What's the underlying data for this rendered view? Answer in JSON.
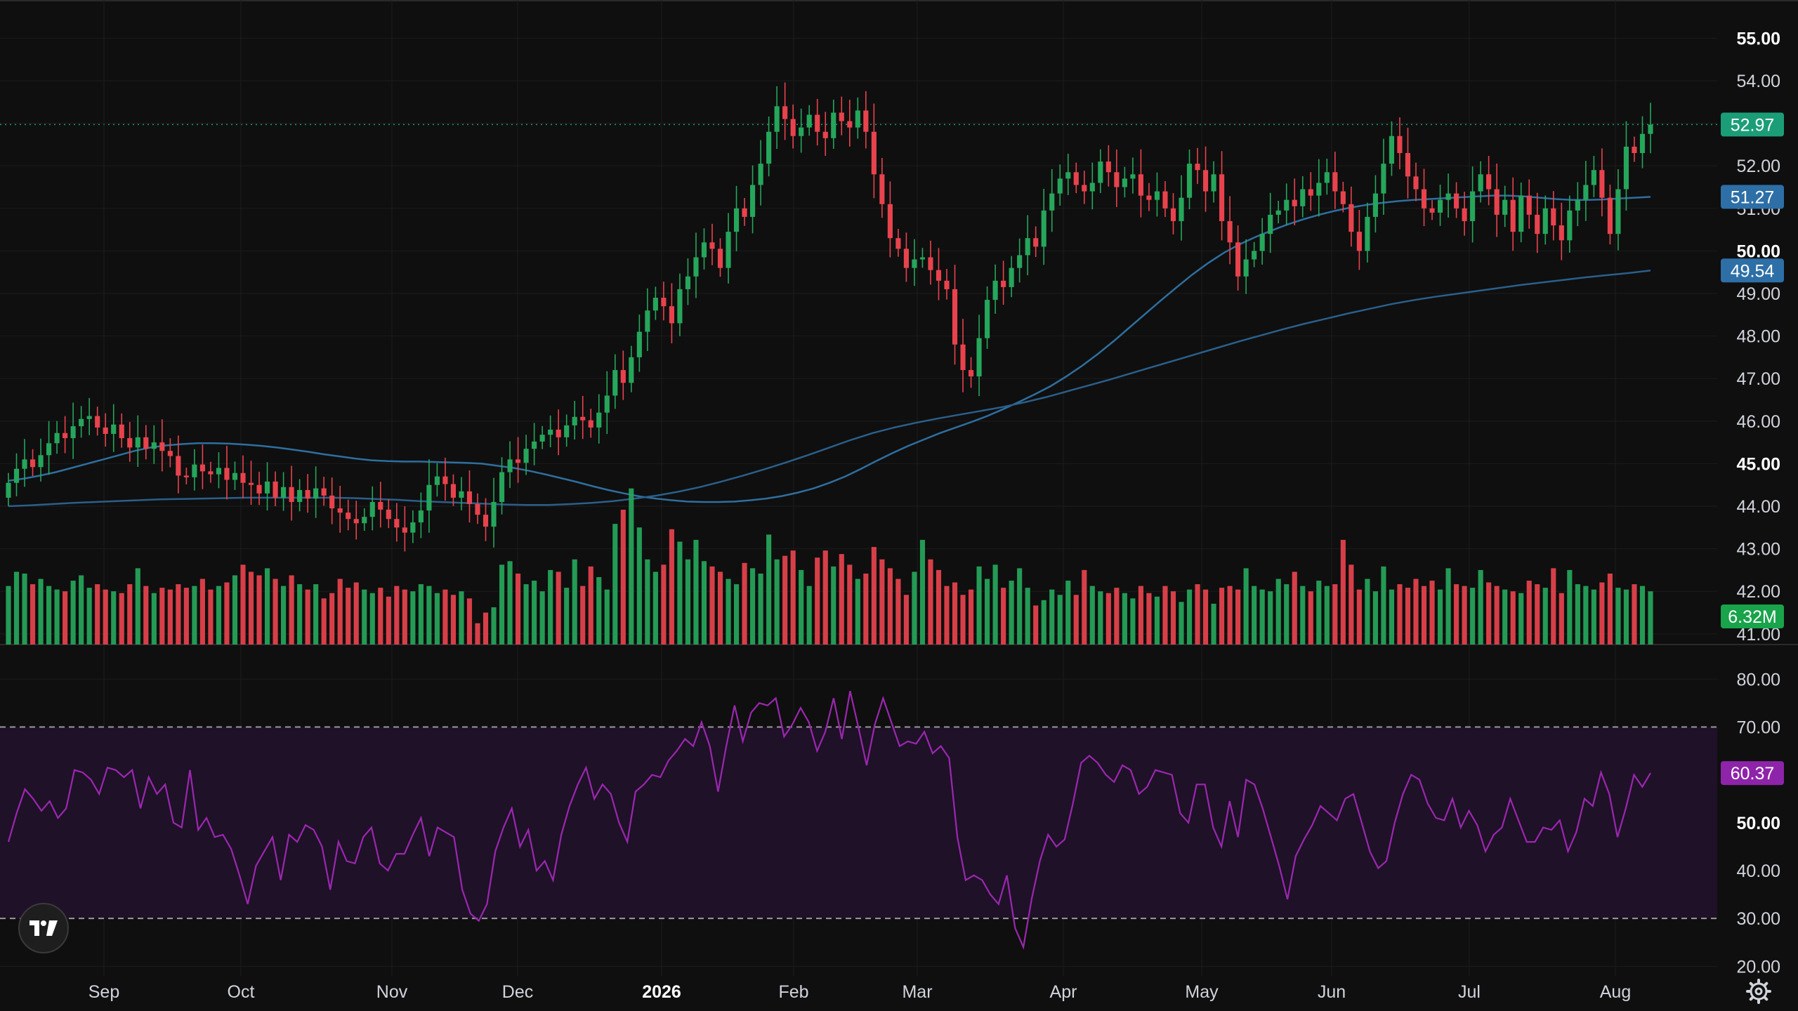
{
  "chart_data": {
    "type": "candlestick",
    "price_axis": {
      "range": [
        40.75,
        55.6
      ],
      "ticks": [
        "55.00",
        "54.00",
        "53.00",
        "52.00",
        "51.00",
        "50.00",
        "49.00",
        "48.00",
        "47.00",
        "46.00",
        "45.00",
        "44.00",
        "43.00",
        "42.00",
        "41.00"
      ],
      "bold_ticks": [
        "55.00",
        "50.00",
        "45.00"
      ]
    },
    "rsi_axis": {
      "range": [
        18,
        84
      ],
      "ticks": [
        "80.00",
        "70.00",
        "60.00",
        "50.00",
        "40.00",
        "30.00",
        "20.00"
      ],
      "bold_ticks": [
        "50.00"
      ],
      "band": [
        30,
        70
      ]
    },
    "time_axis": {
      "labels": [
        "Sep",
        "Oct",
        "Nov",
        "Dec",
        "2026",
        "Feb",
        "Mar",
        "Apr",
        "May",
        "Jun",
        "Jul",
        "Aug"
      ],
      "bold_labels": [
        "2026"
      ]
    },
    "badges": {
      "last_price": "52.97",
      "ma_fast": "51.27",
      "ma_slow": "49.54",
      "volume": "6.32M",
      "rsi": "60.37"
    },
    "colors": {
      "up": "#26a65b",
      "down": "#e8434d",
      "ma_fast": "#2e6fa0",
      "ma_slow": "#2b5f8a",
      "rsi_line": "#9c27b0",
      "rsi_band": "#1f1128",
      "background": "#0f0f0f",
      "grid": "#1c1c1c",
      "badge_price": "#1b9e77",
      "badge_ma": "#2d6fa6",
      "badge_volume": "#19a34a",
      "badge_rsi": "#8e24aa"
    },
    "candles": {
      "start_date": "2025-08-28",
      "close": [
        44.55,
        44.88,
        45.1,
        44.92,
        45.2,
        45.48,
        45.72,
        45.6,
        45.88,
        46.05,
        46.12,
        45.85,
        45.7,
        45.92,
        45.6,
        45.38,
        45.62,
        45.35,
        45.5,
        45.3,
        45.18,
        44.72,
        44.68,
        44.98,
        44.82,
        44.75,
        44.9,
        44.62,
        44.78,
        44.55,
        44.5,
        44.3,
        44.58,
        44.2,
        44.45,
        44.1,
        44.38,
        44.18,
        44.42,
        44.25,
        43.95,
        43.85,
        43.7,
        43.6,
        43.75,
        44.1,
        43.92,
        43.7,
        43.5,
        43.38,
        43.62,
        43.9,
        44.5,
        44.7,
        44.52,
        44.2,
        44.35,
        44.05,
        43.8,
        43.52,
        44.1,
        44.8,
        45.1,
        45.02,
        45.35,
        45.52,
        45.68,
        45.8,
        45.62,
        45.9,
        46.1,
        46.02,
        45.85,
        46.2,
        46.6,
        47.2,
        46.9,
        47.5,
        48.1,
        48.6,
        48.9,
        48.7,
        48.3,
        49.1,
        49.4,
        49.85,
        50.2,
        50.05,
        49.6,
        50.45,
        51.0,
        50.8,
        51.55,
        52.05,
        52.8,
        53.4,
        53.1,
        52.7,
        52.9,
        53.2,
        52.8,
        52.65,
        53.25,
        53.05,
        52.9,
        53.3,
        52.8,
        51.8,
        51.1,
        50.3,
        50.05,
        49.6,
        49.8,
        49.85,
        49.55,
        49.3,
        49.1,
        47.8,
        47.2,
        47.05,
        47.95,
        48.85,
        49.3,
        49.15,
        49.6,
        49.9,
        50.3,
        50.1,
        50.95,
        51.35,
        51.7,
        51.85,
        51.55,
        51.4,
        51.6,
        52.1,
        51.85,
        51.5,
        51.7,
        51.8,
        51.3,
        51.2,
        51.4,
        51.0,
        50.7,
        51.25,
        52.05,
        51.9,
        51.4,
        51.8,
        50.7,
        50.2,
        49.4,
        49.8,
        50.0,
        50.4,
        50.85,
        50.95,
        51.2,
        51.05,
        51.45,
        51.3,
        51.6,
        51.85,
        51.4,
        51.1,
        50.45,
        50.0,
        50.8,
        51.35,
        52.05,
        52.7,
        52.3,
        51.75,
        51.45,
        51.0,
        50.9,
        51.2,
        51.35,
        51.0,
        50.7,
        51.4,
        51.8,
        51.45,
        50.85,
        51.2,
        50.45,
        51.3,
        50.85,
        50.4,
        51.0,
        50.6,
        50.25,
        50.95,
        51.2,
        51.55,
        51.9,
        51.25,
        50.4,
        51.45,
        52.45,
        52.3,
        52.75,
        52.97
      ],
      "open": [
        44.2,
        44.55,
        44.88,
        45.1,
        44.92,
        45.2,
        45.48,
        45.72,
        45.6,
        45.88,
        46.05,
        46.12,
        45.85,
        45.7,
        45.92,
        45.6,
        45.38,
        45.62,
        45.35,
        45.5,
        45.3,
        45.18,
        44.72,
        44.68,
        44.98,
        44.82,
        44.75,
        44.9,
        44.62,
        44.78,
        44.55,
        44.5,
        44.3,
        44.58,
        44.2,
        44.45,
        44.1,
        44.38,
        44.18,
        44.42,
        44.25,
        43.95,
        43.85,
        43.7,
        43.6,
        43.75,
        44.1,
        43.92,
        43.7,
        43.5,
        43.38,
        43.62,
        43.9,
        44.5,
        44.7,
        44.52,
        44.2,
        44.35,
        44.05,
        43.8,
        43.52,
        44.1,
        44.8,
        45.1,
        45.02,
        45.35,
        45.52,
        45.68,
        45.8,
        45.62,
        45.9,
        46.1,
        46.02,
        45.85,
        46.2,
        46.6,
        47.2,
        46.9,
        47.5,
        48.1,
        48.6,
        48.9,
        48.7,
        48.3,
        49.1,
        49.4,
        49.85,
        50.2,
        50.05,
        49.6,
        50.45,
        51.0,
        50.8,
        51.55,
        52.05,
        52.8,
        53.4,
        53.1,
        52.7,
        52.9,
        53.2,
        52.8,
        52.65,
        53.25,
        53.05,
        52.9,
        53.3,
        52.8,
        51.8,
        51.1,
        50.3,
        50.05,
        49.6,
        49.8,
        49.85,
        49.55,
        49.3,
        49.1,
        47.8,
        47.2,
        47.05,
        47.95,
        48.85,
        49.3,
        49.15,
        49.6,
        49.9,
        50.3,
        50.1,
        50.95,
        51.35,
        51.7,
        51.85,
        51.55,
        51.4,
        51.6,
        52.1,
        51.85,
        51.5,
        51.7,
        51.8,
        51.3,
        51.2,
        51.4,
        51.0,
        50.7,
        51.25,
        52.05,
        51.9,
        51.4,
        51.8,
        50.7,
        50.2,
        49.4,
        49.8,
        50.0,
        50.4,
        50.85,
        50.95,
        51.2,
        51.05,
        51.45,
        51.3,
        51.6,
        51.85,
        51.4,
        51.1,
        50.45,
        50.0,
        50.8,
        51.35,
        52.05,
        52.7,
        52.3,
        51.75,
        51.45,
        51.0,
        50.9,
        51.2,
        51.35,
        51.0,
        50.7,
        51.4,
        51.8,
        51.45,
        50.85,
        51.2,
        50.45,
        51.3,
        50.85,
        50.4,
        51.0,
        50.6,
        50.25,
        50.95,
        51.2,
        51.55,
        51.9,
        51.25,
        50.4,
        51.45,
        52.45,
        52.3,
        52.75
      ],
      "volume_millions": [
        6.6,
        8.2,
        8.0,
        6.8,
        7.4,
        6.6,
        6.2,
        6.0,
        7.2,
        7.8,
        6.4,
        6.8,
        6.2,
        6.0,
        5.8,
        6.8,
        8.6,
        6.6,
        5.8,
        6.4,
        6.2,
        6.8,
        6.4,
        6.6,
        7.4,
        6.2,
        6.6,
        7.0,
        7.8,
        9.0,
        8.2,
        7.8,
        8.6,
        7.4,
        6.6,
        7.8,
        6.8,
        6.2,
        6.8,
        5.2,
        5.8,
        7.4,
        6.4,
        7.0,
        6.2,
        5.8,
        6.4,
        5.4,
        6.6,
        6.2,
        6.0,
        6.8,
        6.6,
        5.8,
        6.2,
        5.6,
        6.0,
        5.2,
        2.4,
        3.6,
        4.2,
        9.0,
        9.4,
        8.0,
        6.8,
        7.2,
        6.0,
        8.4,
        8.2,
        6.4,
        9.6,
        6.6,
        8.8,
        7.6,
        6.2,
        13.6,
        15.2,
        17.6,
        13.2,
        9.6,
        8.2,
        9.0,
        13.0,
        11.6,
        9.6,
        11.8,
        9.4,
        8.8,
        8.2,
        7.4,
        6.8,
        9.2,
        8.6,
        8.0,
        12.4,
        9.6,
        10.0,
        10.6,
        8.4,
        6.6,
        9.8,
        10.6,
        8.8,
        10.2,
        9.0,
        7.4,
        8.0,
        11.0,
        9.6,
        8.6,
        7.4,
        5.6,
        8.2,
        11.8,
        9.6,
        8.4,
        6.6,
        7.0,
        5.6,
        6.2,
        8.8,
        7.4,
        9.0,
        6.4,
        7.2,
        8.6,
        6.4,
        4.4,
        5.0,
        6.2,
        5.6,
        7.2,
        5.6,
        8.4,
        6.6,
        6.0,
        5.8,
        6.4,
        5.8,
        5.2,
        6.6,
        5.8,
        5.4,
        6.6,
        6.0,
        4.8,
        6.2,
        6.8,
        6.2,
        4.6,
        6.4,
        6.6,
        6.2,
        8.6,
        6.6,
        6.2,
        6.0,
        7.4,
        6.8,
        8.2,
        6.6,
        6.0,
        7.2,
        6.6,
        6.8,
        11.8,
        9.0,
        6.2,
        7.4,
        6.0,
        8.8,
        6.2,
        6.8,
        6.4,
        7.4,
        6.6,
        7.2,
        6.2,
        8.6,
        6.8,
        6.6,
        6.4,
        8.4,
        7.0,
        6.6,
        6.2,
        6.0,
        5.8,
        7.2,
        6.8,
        6.4,
        8.6,
        5.8,
        8.4,
        6.8,
        6.6,
        6.2,
        7.0,
        8.0,
        6.4,
        6.2,
        6.8,
        6.6,
        6.0,
        5.8,
        6.2,
        6.8,
        7.0,
        6.2,
        6.6,
        6.4,
        6.8,
        7.8,
        6.4,
        6.2,
        6.0,
        8.4,
        6.32
      ]
    },
    "rsi": {
      "start_date": "2025-08-28",
      "values": [
        46.0,
        52.0,
        57.0,
        55.0,
        52.5,
        54.5,
        51.0,
        53.0,
        61.0,
        60.5,
        59.0,
        56.0,
        61.5,
        61.0,
        59.5,
        61.0,
        53.0,
        59.5,
        56.0,
        58.0,
        50.0,
        49.0,
        61.0,
        48.5,
        51.0,
        47.0,
        47.5,
        44.5,
        39.0,
        33.0,
        41.0,
        44.0,
        47.0,
        38.0,
        47.5,
        46.0,
        49.5,
        48.5,
        45.0,
        36.0,
        46.0,
        42.0,
        41.5,
        47.0,
        49.0,
        41.5,
        40.0,
        43.5,
        43.5,
        47.5,
        51.0,
        43.0,
        49.0,
        48.0,
        47.0,
        36.0,
        31.0,
        29.5,
        33.0,
        44.0,
        49.0,
        53.0,
        45.0,
        48.5,
        40.0,
        42.0,
        38.0,
        47.5,
        53.5,
        58.0,
        61.5,
        55.0,
        58.0,
        56.0,
        50.0,
        46.0,
        56.5,
        58.0,
        60.0,
        59.5,
        63.0,
        65.0,
        67.5,
        66.0,
        71.0,
        66.0,
        56.5,
        66.0,
        74.5,
        67.0,
        73.0,
        75.0,
        74.5,
        76.0,
        68.0,
        70.5,
        74.0,
        71.0,
        65.0,
        69.0,
        76.0,
        67.5,
        77.5,
        70.0,
        62.0,
        70.5,
        76.0,
        71.0,
        66.0,
        67.0,
        66.5,
        69.0,
        64.5,
        66.0,
        63.5,
        47.0,
        38.0,
        39.0,
        38.0,
        35.0,
        33.0,
        39.0,
        28.0,
        24.0,
        34.0,
        42.0,
        47.5,
        45.0,
        46.5,
        54.0,
        62.5,
        64.0,
        62.5,
        60.0,
        58.5,
        62.0,
        61.0,
        56.0,
        57.5,
        61.0,
        60.5,
        60.0,
        52.0,
        50.0,
        58.0,
        58.0,
        49.0,
        45.0,
        54.5,
        47.0,
        59.0,
        58.0,
        53.0,
        47.0,
        41.0,
        34.0,
        43.0,
        46.5,
        49.5,
        53.5,
        52.0,
        50.5,
        55.0,
        56.0,
        50.0,
        44.0,
        40.5,
        42.0,
        50.0,
        56.0,
        60.0,
        59.0,
        54.0,
        51.0,
        50.5,
        55.0,
        49.0,
        52.5,
        49.5,
        44.0,
        47.5,
        49.0,
        55.0,
        50.5,
        46.0,
        46.0,
        49.0,
        48.5,
        50.5,
        44.0,
        48.0,
        55.0,
        53.5,
        60.5,
        56.0,
        47.0,
        53.0,
        60.0,
        57.5,
        60.37
      ]
    },
    "ma_fast": [
      44.6,
      44.65,
      44.72,
      44.8,
      44.9,
      45.0,
      45.1,
      45.2,
      45.3,
      45.38,
      45.43,
      45.46,
      45.48,
      45.48,
      45.47,
      45.45,
      45.42,
      45.38,
      45.33,
      45.28,
      45.22,
      45.17,
      45.12,
      45.08,
      45.06,
      45.05,
      45.05,
      45.04,
      45.03,
      45.02,
      45.0,
      44.95,
      44.9,
      44.83,
      44.75,
      44.66,
      44.57,
      44.47,
      44.38,
      44.3,
      44.23,
      44.18,
      44.14,
      44.11,
      44.1,
      44.1,
      44.11,
      44.14,
      44.18,
      44.24,
      44.32,
      44.42,
      44.55,
      44.7,
      44.88,
      45.07,
      45.25,
      45.42,
      45.57,
      45.72,
      45.85,
      45.98,
      46.12,
      46.28,
      46.45,
      46.63,
      46.82,
      47.05,
      47.3,
      47.58,
      47.88,
      48.2,
      48.52,
      48.84,
      49.15,
      49.45,
      49.72,
      49.96,
      50.16,
      50.33,
      50.48,
      50.62,
      50.74,
      50.85,
      50.94,
      51.02,
      51.08,
      51.13,
      51.17,
      51.2,
      51.22,
      51.24,
      51.26,
      51.28,
      51.3,
      51.3,
      51.28,
      51.25,
      51.22,
      51.2,
      51.2,
      51.21,
      51.23,
      51.25,
      51.27
    ],
    "ma_slow": [
      44.0,
      44.02,
      44.05,
      44.08,
      44.1,
      44.12,
      44.14,
      44.16,
      44.17,
      44.18,
      44.19,
      44.2,
      44.2,
      44.2,
      44.2,
      44.2,
      44.19,
      44.17,
      44.15,
      44.12,
      44.1,
      44.08,
      44.06,
      44.04,
      44.03,
      44.03,
      44.05,
      44.08,
      44.12,
      44.18,
      44.25,
      44.34,
      44.45,
      44.58,
      44.72,
      44.87,
      45.03,
      45.2,
      45.38,
      45.56,
      45.72,
      45.85,
      45.96,
      46.06,
      46.15,
      46.24,
      46.33,
      46.44,
      46.56,
      46.7,
      46.84,
      46.98,
      47.13,
      47.28,
      47.43,
      47.58,
      47.73,
      47.88,
      48.02,
      48.16,
      48.29,
      48.41,
      48.53,
      48.64,
      48.75,
      48.84,
      48.92,
      48.99,
      49.06,
      49.13,
      49.2,
      49.26,
      49.32,
      49.38,
      49.43,
      49.48,
      49.54
    ]
  }
}
